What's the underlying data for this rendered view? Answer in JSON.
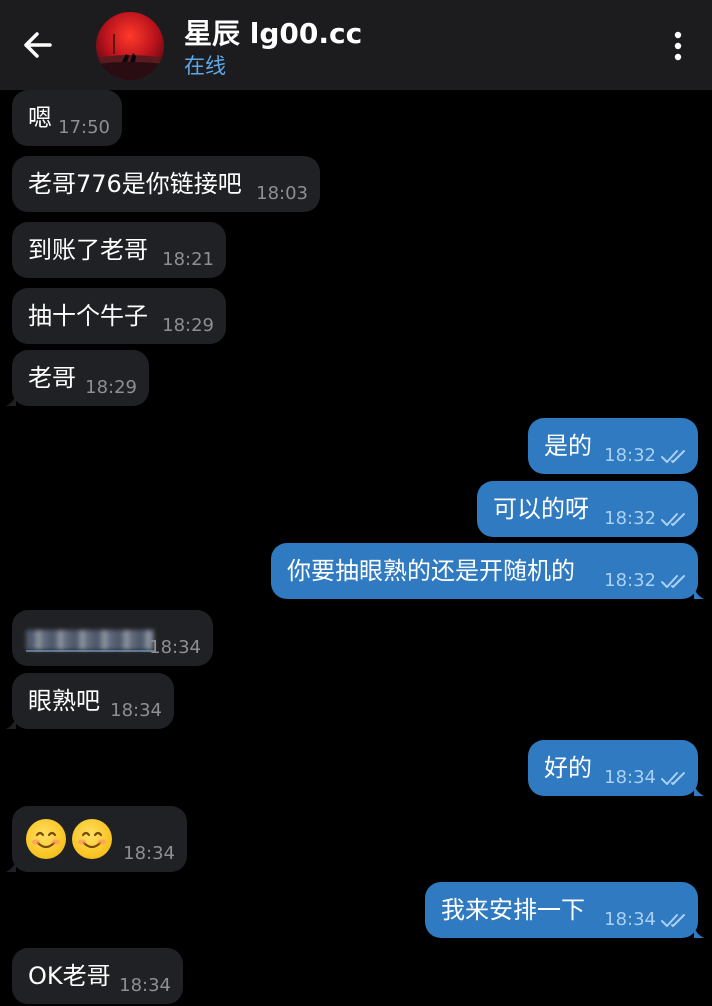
{
  "header": {
    "title": "星辰 lg00.cc",
    "status": "在线"
  },
  "messages": [
    {
      "dir": "in",
      "text": "嗯",
      "time": "17:50"
    },
    {
      "dir": "in",
      "text": "老哥776是你链接吧",
      "time": "18:03"
    },
    {
      "dir": "in",
      "text": "到账了老哥",
      "time": "18:21"
    },
    {
      "dir": "in",
      "text": "抽十个牛子",
      "time": "18:29"
    },
    {
      "dir": "in",
      "text": "老哥",
      "time": "18:29"
    },
    {
      "dir": "out",
      "text": "是的",
      "time": "18:32"
    },
    {
      "dir": "out",
      "text": "可以的呀",
      "time": "18:32"
    },
    {
      "dir": "out",
      "text": "你要抽眼熟的还是开随机的",
      "time": "18:32"
    },
    {
      "dir": "in",
      "text": "",
      "time": "18:34"
    },
    {
      "dir": "in",
      "text": "眼熟吧",
      "time": "18:34"
    },
    {
      "dir": "out",
      "text": "好的",
      "time": "18:34"
    },
    {
      "dir": "in",
      "text": "😊😊",
      "time": "18:34"
    },
    {
      "dir": "out",
      "text": "我来安排一下",
      "time": "18:34"
    },
    {
      "dir": "in",
      "text": "OK老哥",
      "time": "18:34"
    }
  ],
  "colors": {
    "header_bg": "#1c1c1e",
    "incoming_bubble": "#202124",
    "outgoing_bubble": "#2f7ac0",
    "status_blue": "#5fa8e8"
  },
  "icons": [
    "back-arrow-icon",
    "more-vertical-icon",
    "double-check-icon"
  ]
}
